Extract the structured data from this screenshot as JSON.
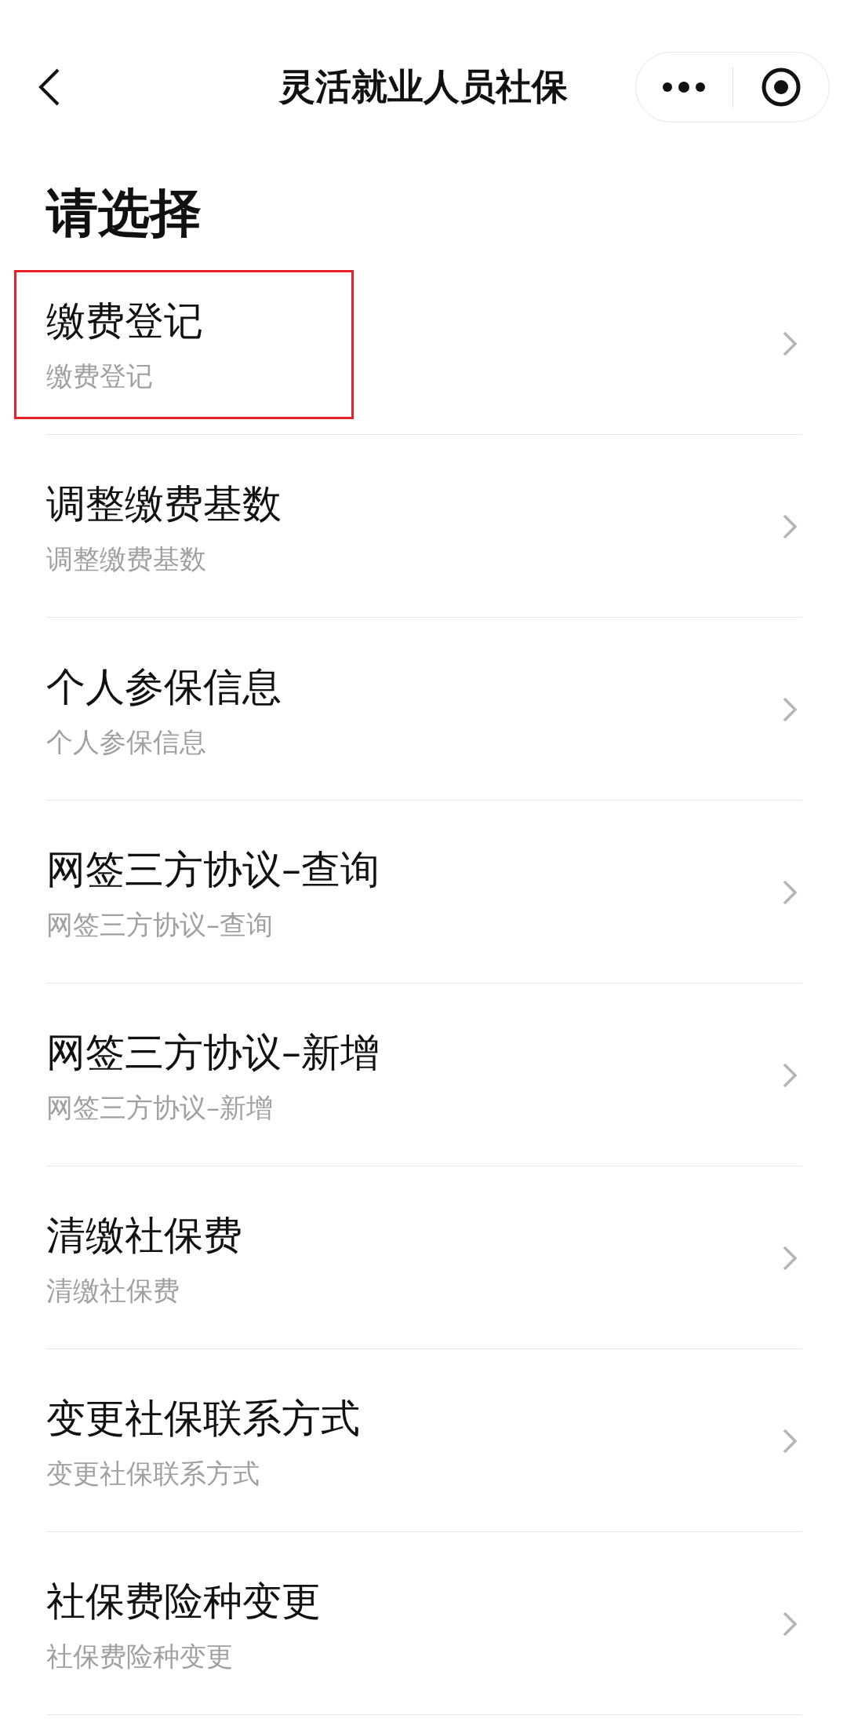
{
  "header": {
    "title": "灵活就业人员社保"
  },
  "heading": "请选择",
  "items": [
    {
      "title": "缴费登记",
      "subtitle": "缴费登记",
      "highlighted": true
    },
    {
      "title": "调整缴费基数",
      "subtitle": "调整缴费基数",
      "highlighted": false
    },
    {
      "title": "个人参保信息",
      "subtitle": "个人参保信息",
      "highlighted": false
    },
    {
      "title": "网签三方协议–查询",
      "subtitle": "网签三方协议–查询",
      "highlighted": false
    },
    {
      "title": "网签三方协议–新增",
      "subtitle": "网签三方协议–新增",
      "highlighted": false
    },
    {
      "title": "清缴社保费",
      "subtitle": "清缴社保费",
      "highlighted": false
    },
    {
      "title": "变更社保联系方式",
      "subtitle": "变更社保联系方式",
      "highlighted": false
    },
    {
      "title": "社保费险种变更",
      "subtitle": "社保费险种变更",
      "highlighted": false
    }
  ]
}
